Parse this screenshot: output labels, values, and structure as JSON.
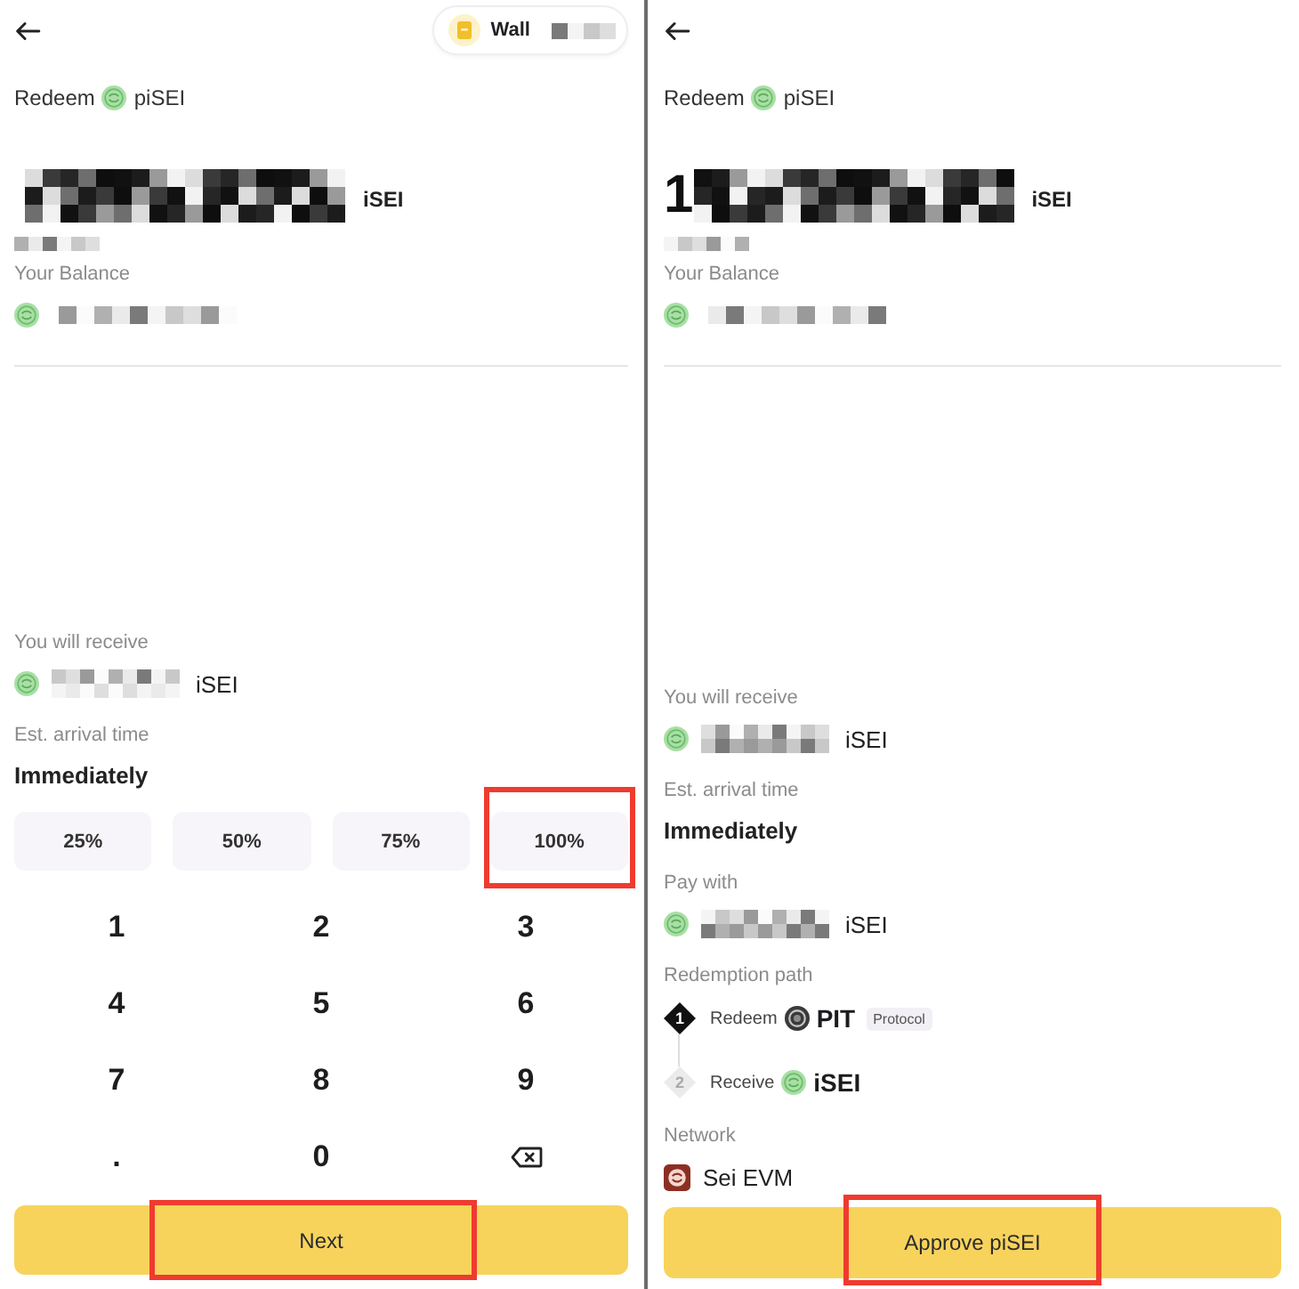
{
  "screens": [
    {
      "wallet_button": {
        "label": "Wall",
        "redacted": true
      },
      "title": {
        "action": "Redeem",
        "token": "piSEI"
      },
      "amount": {
        "redacted": true,
        "unit": "iSEI"
      },
      "fiat_value": {
        "redacted": true
      },
      "balance": {
        "label": "Your Balance",
        "redacted": true
      },
      "details": [
        {
          "kind": "token",
          "label": "You will receive",
          "redacted": true,
          "unit": "iSEI"
        },
        {
          "kind": "text",
          "label": "Est. arrival time",
          "value": "Immediately"
        }
      ],
      "presets": [
        {
          "label": "25%",
          "highlighted": false
        },
        {
          "label": "50%",
          "highlighted": false
        },
        {
          "label": "75%",
          "highlighted": false
        },
        {
          "label": "100%",
          "highlighted": true
        }
      ],
      "keypad": [
        {
          "kind": "digit",
          "label": "1"
        },
        {
          "kind": "digit",
          "label": "2"
        },
        {
          "kind": "digit",
          "label": "3"
        },
        {
          "kind": "digit",
          "label": "4"
        },
        {
          "kind": "digit",
          "label": "5"
        },
        {
          "kind": "digit",
          "label": "6"
        },
        {
          "kind": "digit",
          "label": "7"
        },
        {
          "kind": "digit",
          "label": "8"
        },
        {
          "kind": "digit",
          "label": "9"
        },
        {
          "kind": "digit",
          "label": "."
        },
        {
          "kind": "digit",
          "label": "0"
        },
        {
          "kind": "backspace"
        }
      ],
      "action_button": {
        "label": "Next",
        "highlighted": true
      }
    },
    {
      "title": {
        "action": "Redeem",
        "token": "piSEI"
      },
      "amount": {
        "digits": "1",
        "redacted": true,
        "unit": "iSEI"
      },
      "fiat_value": {
        "redacted": true
      },
      "balance": {
        "label": "Your Balance",
        "redacted": true
      },
      "details": [
        {
          "kind": "token",
          "label": "You will receive",
          "redacted": true,
          "unit": "iSEI"
        },
        {
          "kind": "text",
          "label": "Est. arrival time",
          "value": "Immediately"
        },
        {
          "kind": "token",
          "label": "Pay with",
          "redacted": true,
          "unit": "iSEI"
        },
        {
          "kind": "path",
          "label": "Redemption path",
          "steps": [
            {
              "kind": "protocol",
              "number": "1",
              "action": "Redeem",
              "name": "PIT",
              "tag": "Protocol",
              "active": true
            },
            {
              "kind": "token",
              "number": "2",
              "action": "Receive",
              "name": "iSEI",
              "active": false
            }
          ]
        },
        {
          "kind": "network",
          "label": "Network",
          "value": "Sei EVM"
        }
      ],
      "action_button": {
        "label": "Approve piSEI",
        "highlighted": true
      }
    }
  ]
}
